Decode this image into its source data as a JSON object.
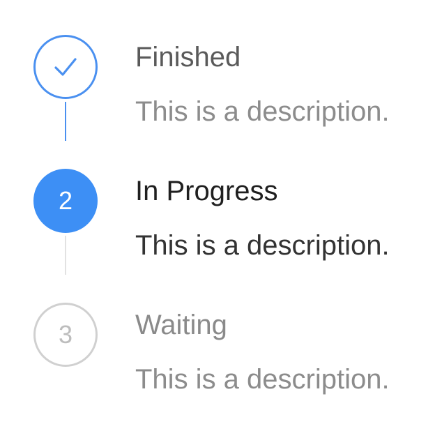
{
  "steps": [
    {
      "status": "finished",
      "icon": "check-icon",
      "title": "Finished",
      "description": "This is a description."
    },
    {
      "status": "process",
      "number": "2",
      "title": "In Progress",
      "description": "This is a description."
    },
    {
      "status": "wait",
      "number": "3",
      "title": "Waiting",
      "description": "This is a description."
    }
  ],
  "colors": {
    "accent": "#3d8ff5",
    "finished_border": "#4a90f0",
    "wait_border": "#d0d0d0",
    "connector_done": "#4a90f0",
    "connector_pending": "#e2e2e2",
    "title_active": "#1f1f1f",
    "text_muted": "#8c8c8c"
  }
}
